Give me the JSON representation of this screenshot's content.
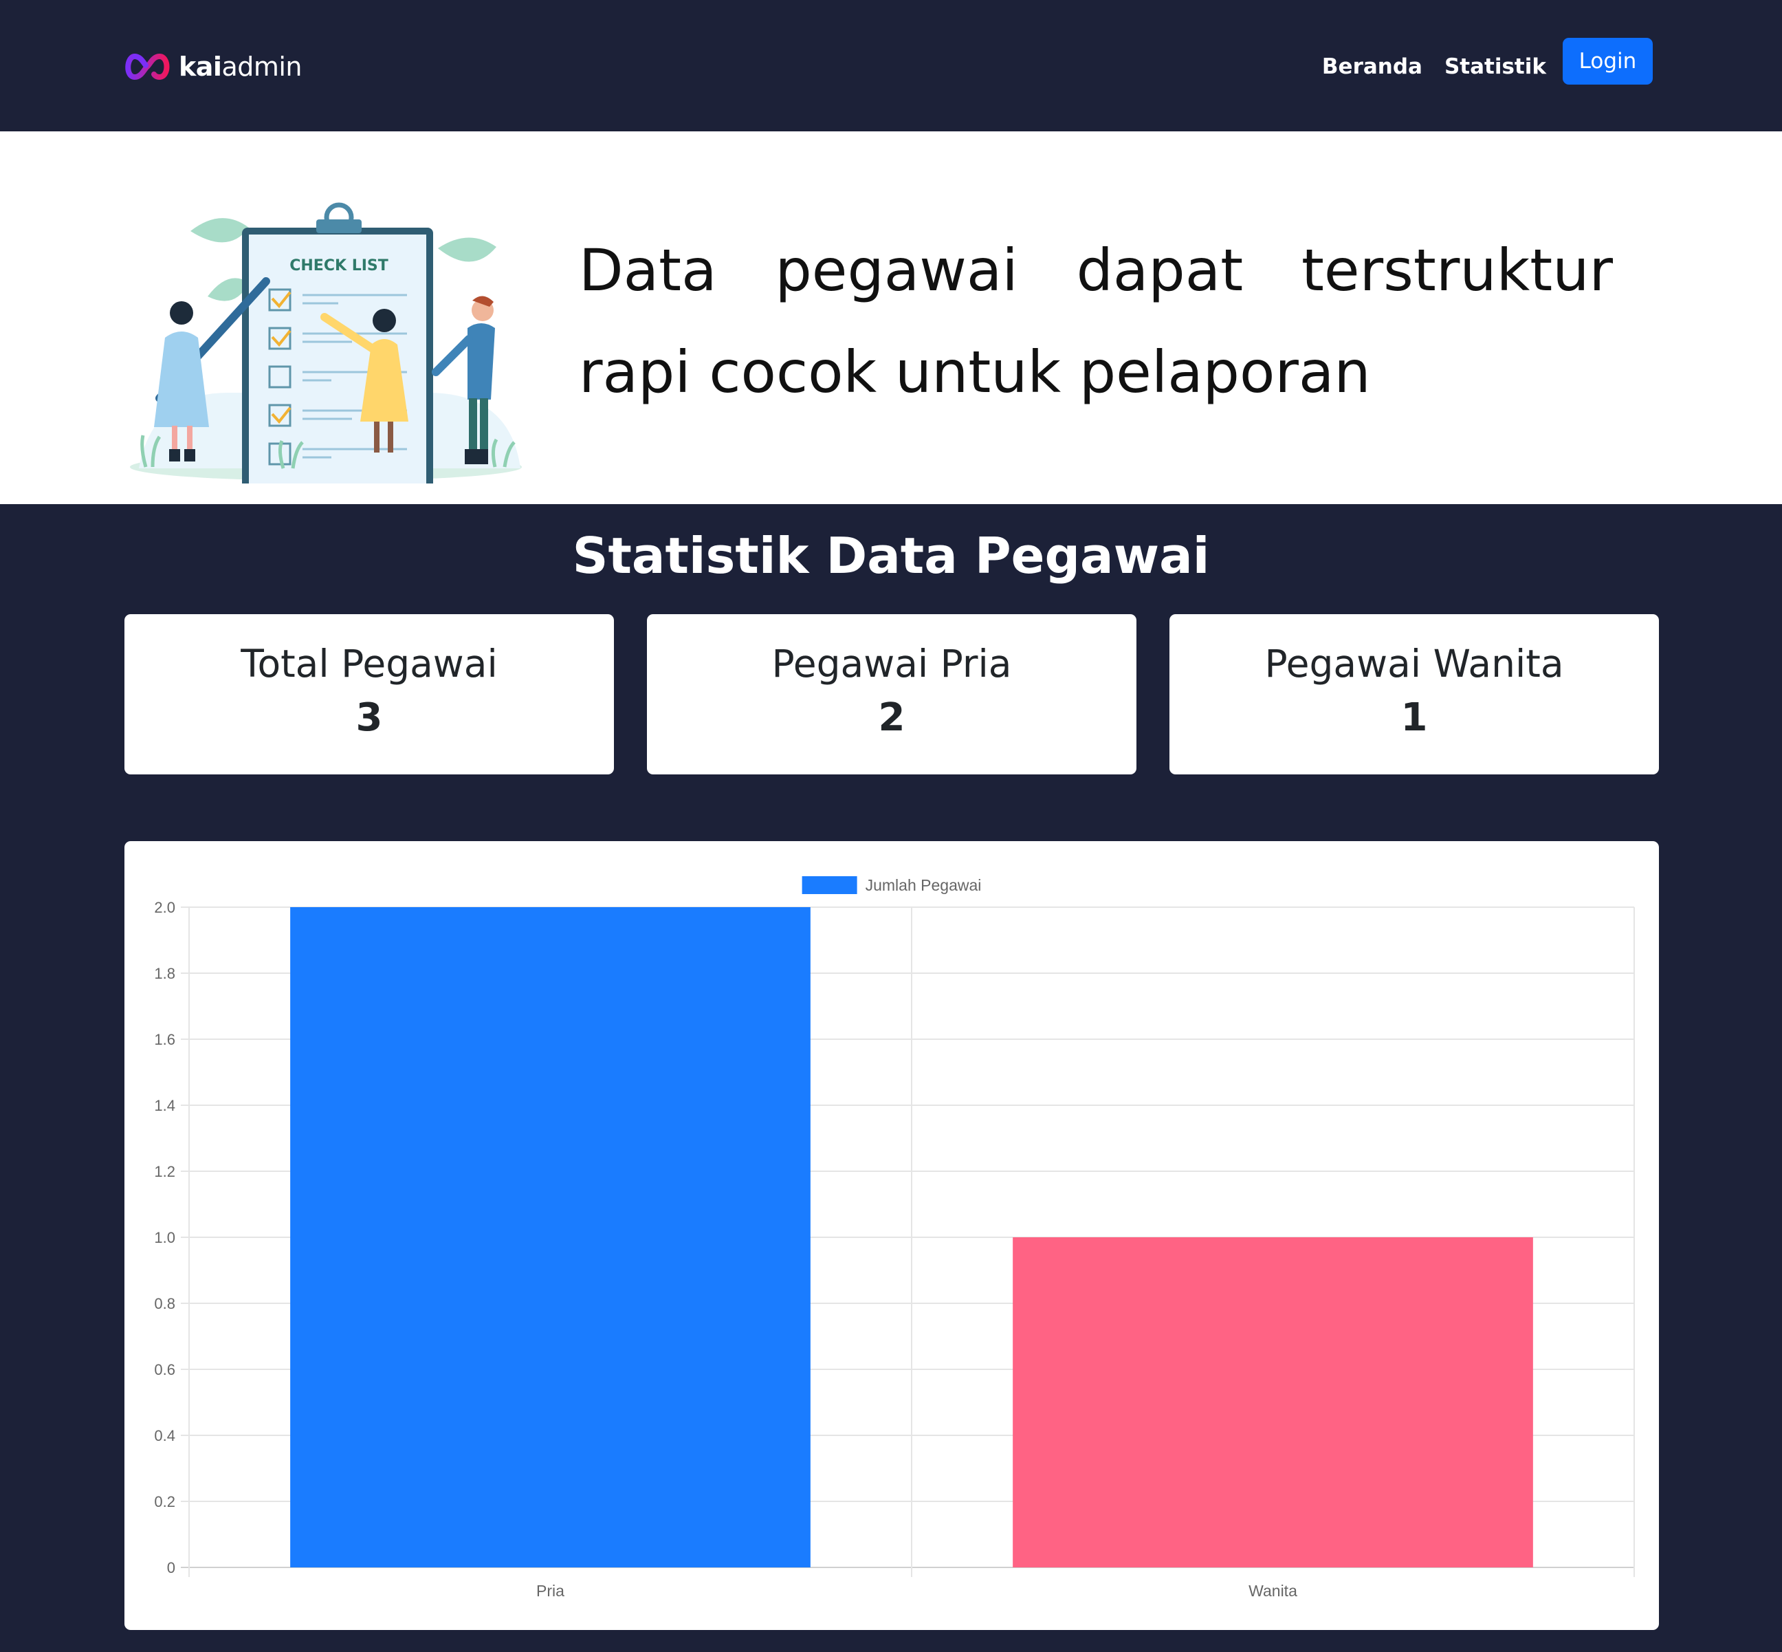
{
  "navbar": {
    "brand_bold": "kai",
    "brand_light": "admin",
    "links": [
      "Beranda",
      "Statistik"
    ],
    "login_label": "Login"
  },
  "hero": {
    "illustration_label": "CHECK LIST",
    "headline_line1": [
      "Data",
      "pegawai",
      "dapat",
      "terstruktur"
    ],
    "headline_line2": "rapi cocok untuk pelaporan"
  },
  "stats": {
    "title": "Statistik Data Pegawai",
    "cards": [
      {
        "label": "Total Pegawai",
        "value": "3"
      },
      {
        "label": "Pegawai Pria",
        "value": "2"
      },
      {
        "label": "Pegawai Wanita",
        "value": "1"
      }
    ]
  },
  "chart_data": {
    "type": "bar",
    "categories": [
      "Pria",
      "Wanita"
    ],
    "series": [
      {
        "name": "Jumlah Pegawai",
        "values": [
          2,
          1
        ],
        "colors": [
          "#1a7cff",
          "#ff6384"
        ]
      }
    ],
    "legend_color": "#1a7cff",
    "title": "",
    "xlabel": "",
    "ylabel": "",
    "ylim": [
      0,
      2.0
    ],
    "yticks": [
      "0",
      "0.2",
      "0.4",
      "0.6",
      "0.8",
      "1.0",
      "1.2",
      "1.4",
      "1.6",
      "1.8",
      "2.0"
    ],
    "grid": true,
    "legend_position": "top-center"
  }
}
